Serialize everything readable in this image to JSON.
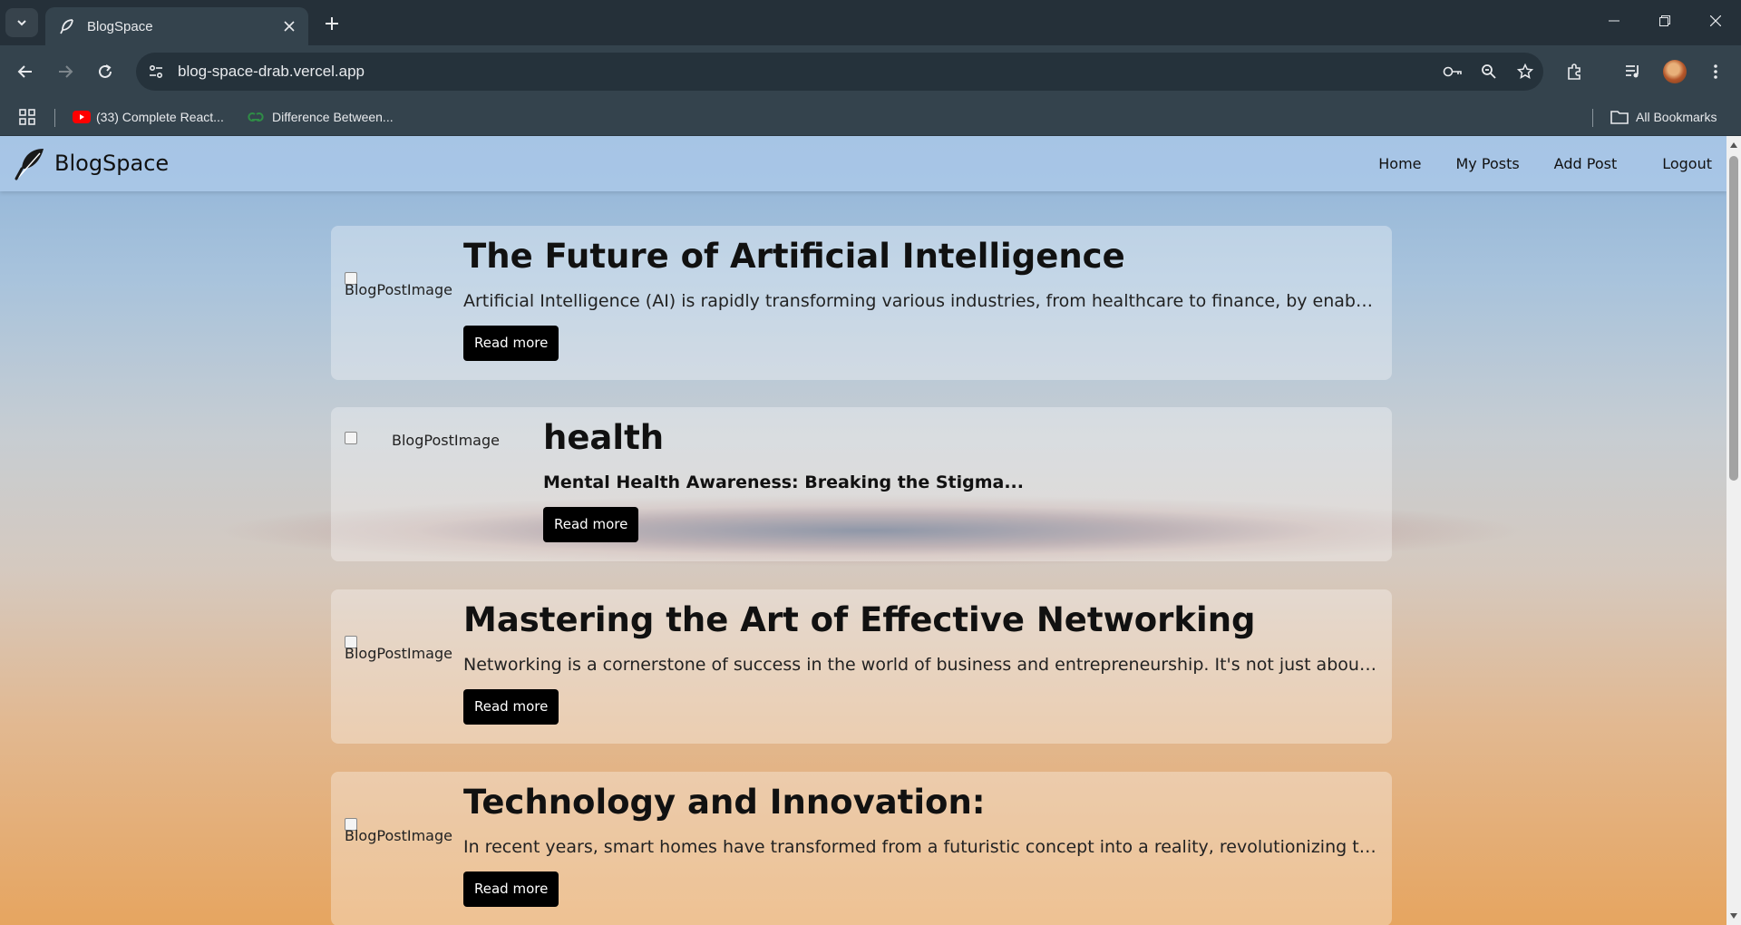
{
  "browser": {
    "tab_title": "BlogSpace",
    "url": "blog-space-drab.vercel.app",
    "bookmarks": [
      {
        "label": "(33) Complete React...",
        "icon": "youtube-icon"
      },
      {
        "label": "Difference Between...",
        "icon": "geeksforgeeks-icon"
      }
    ],
    "all_bookmarks_label": "All Bookmarks"
  },
  "site": {
    "brand": "BlogSpace",
    "nav": [
      "Home",
      "My Posts",
      "Add Post",
      "Logout"
    ]
  },
  "posts": [
    {
      "image_alt": "BlogPostImage",
      "title": "The Future of Artificial Intelligence",
      "excerpt": "Artificial Intelligence (AI) is rapidly transforming various industries, from healthcare to finance, by enablin...",
      "button": "Read more"
    },
    {
      "image_alt": "BlogPostImage",
      "title": "health",
      "excerpt": "Mental Health Awareness: Breaking the Stigma...",
      "button": "Read more"
    },
    {
      "image_alt": "BlogPostImage",
      "title": "Mastering the Art of Effective Networking",
      "excerpt": "Networking is a cornerstone of success in the world of business and entrepreneurship. It's not just about...",
      "button": "Read more"
    },
    {
      "image_alt": "BlogPostImage",
      "title": "Technology and Innovation:",
      "excerpt": "In recent years, smart homes have transformed from a futuristic concept into a reality, revolutionizing the...",
      "button": "Read more"
    }
  ]
}
